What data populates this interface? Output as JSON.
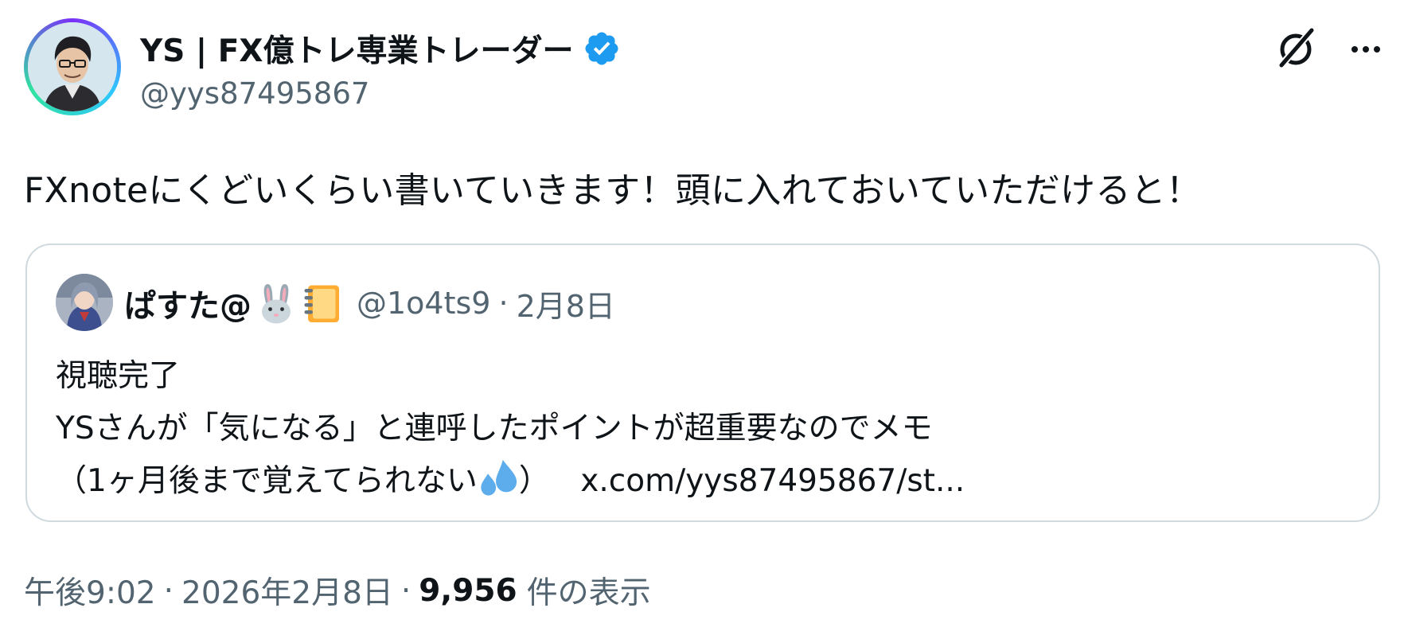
{
  "author": {
    "display_name": "YS | FX億トレ専業トレーダー",
    "handle": "@yys87495867",
    "verified": true,
    "verified_color": "#1d9bf0"
  },
  "actions": {
    "grok_icon": "grok-icon",
    "more_icon": "more-icon"
  },
  "tweet": {
    "text": "FXnoteにくどいくらい書いていきます！頭に入れておいていただけると！"
  },
  "quote": {
    "display_name": "ぱすた@",
    "name_emojis": [
      "rabbit-emoji",
      "notebook-emoji"
    ],
    "handle": "@1o4ts9",
    "separator": "·",
    "date": "2月8日",
    "lines": [
      "視聴完了",
      "YSさんが「気になる」と連呼したポイントが超重要なのでメモ",
      "（1ヶ月後まで覚えてられない"
    ],
    "line3_emoji": "sweat-droplets-emoji",
    "line3_close": "）",
    "link": "x.com/yys87495867/st..."
  },
  "meta": {
    "time": "午後9:02",
    "separator": "·",
    "date": "2026年2月8日",
    "views_count": "9,956",
    "views_label": "件の表示"
  }
}
